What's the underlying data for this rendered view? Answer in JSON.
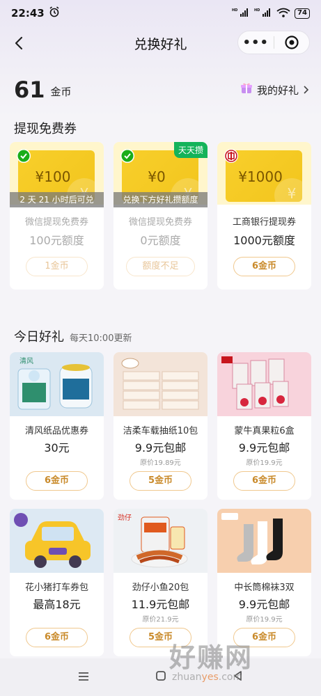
{
  "status_bar": {
    "time": "22:43",
    "network": "HD",
    "battery": "74"
  },
  "nav": {
    "title": "兑换好礼"
  },
  "wallet": {
    "coins": "61",
    "unit": "金币",
    "my_gifts": "我的好礼"
  },
  "vouchers_section": {
    "title": "提现免费券",
    "items": [
      {
        "amount": "¥100",
        "overlay": "2 天 21 小时后可兑",
        "badge": "",
        "name": "微信提现免费券",
        "limit": "100元额度",
        "button": "1金币",
        "disabled": true,
        "logo": "wechat-icon"
      },
      {
        "amount": "¥0",
        "overlay": "兑换下方好礼攒额度",
        "badge": "天天攒",
        "name": "微信提现免费券",
        "limit": "0元额度",
        "button": "额度不足",
        "disabled": true,
        "logo": "wechat-icon"
      },
      {
        "amount": "¥1000",
        "overlay": "",
        "badge": "",
        "name": "工商银行提现券",
        "limit": "1000元额度",
        "button": "6金币",
        "disabled": false,
        "logo": "icbc-icon"
      }
    ]
  },
  "gifts_section": {
    "title": "今日好礼",
    "subtitle": "每天10:00更新",
    "items": [
      {
        "name": "清风纸品优惠券",
        "price": "30元",
        "original": "",
        "button": "6金币"
      },
      {
        "name": "洁柔车载抽纸10包",
        "price": "9.9元包邮",
        "original": "原价19.89元",
        "button": "5金币"
      },
      {
        "name": "蒙牛真果粒6盒",
        "price": "9.9元包邮",
        "original": "原价19.9元",
        "button": "6金币"
      },
      {
        "name": "花小猪打车券包",
        "price": "最高18元",
        "original": "",
        "button": "6金币"
      },
      {
        "name": "劲仔小鱼20包",
        "price": "11.9元包邮",
        "original": "原价21.9元",
        "button": "5金币"
      },
      {
        "name": "中长筒棉袜3双",
        "price": "9.9元包邮",
        "original": "原价19.9元",
        "button": "6金币"
      }
    ]
  },
  "watermark": {
    "text": "好赚网",
    "url_a": "zhuan",
    "url_b": "yes",
    "url_c": ".com"
  },
  "colors": {
    "accent": "#c98a2a",
    "voucher_gold": "#f8cf2b",
    "badge_green": "#14b35a"
  }
}
